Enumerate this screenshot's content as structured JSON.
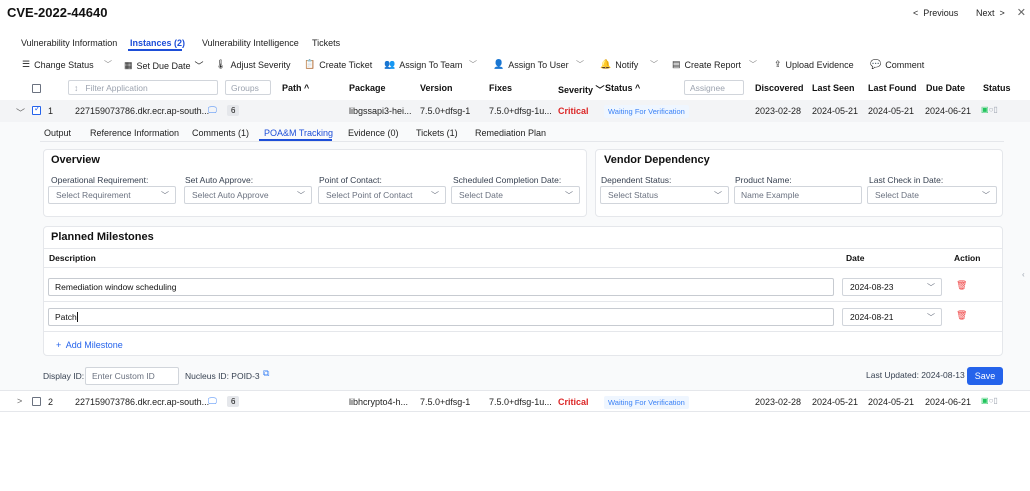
{
  "header": {
    "title": "CVE-2022-44640",
    "previous": "Previous",
    "next": "Next"
  },
  "tabs": [
    {
      "label": "Vulnerability Information"
    },
    {
      "label": "Instances (2)"
    },
    {
      "label": "Vulnerability Intelligence"
    },
    {
      "label": "Tickets"
    }
  ],
  "toolbar": {
    "change_status": "Change Status",
    "set_due_date": "Set Due Date",
    "adjust_severity": "Adjust Severity",
    "create_ticket": "Create Ticket",
    "assign_team": "Assign To Team",
    "assign_user": "Assign To User",
    "notify": "Notify",
    "create_report": "Create Report",
    "upload_evidence": "Upload Evidence",
    "comment": "Comment"
  },
  "table": {
    "filter_application_placeholder": "Filter Application",
    "groups_placeholder": "Groups",
    "assignee_placeholder": "Assignee",
    "headers": {
      "path": "Path",
      "package": "Package",
      "version": "Version",
      "fixes": "Fixes",
      "severity": "Severity",
      "status": "Status",
      "discovered": "Discovered",
      "last_seen": "Last Seen",
      "last_found": "Last Found",
      "due_date": "Due Date",
      "status2": "Status"
    },
    "rows": [
      {
        "index": "1",
        "application": "227159073786.dkr.ecr.ap-south...",
        "groups": "6",
        "package": "libgssapi3-hei...",
        "version": "7.5.0+dfsg-1",
        "fixes": "7.5.0+dfsg-1u...",
        "severity": "Critical",
        "status": "Waiting For Verification",
        "discovered": "2023-02-28",
        "last_seen": "2024-05-21",
        "last_found": "2024-05-21",
        "due_date": "2024-06-21"
      },
      {
        "index": "2",
        "application": "227159073786.dkr.ecr.ap-south...",
        "groups": "6",
        "package": "libhcrypto4-h...",
        "version": "7.5.0+dfsg-1",
        "fixes": "7.5.0+dfsg-1u...",
        "severity": "Critical",
        "status": "Waiting For Verification",
        "discovered": "2023-02-28",
        "last_seen": "2024-05-21",
        "last_found": "2024-05-21",
        "due_date": "2024-06-21"
      }
    ]
  },
  "subtabs": [
    {
      "label": "Output"
    },
    {
      "label": "Reference Information"
    },
    {
      "label": "Comments (1)"
    },
    {
      "label": "POA&M Tracking"
    },
    {
      "label": "Evidence (0)"
    },
    {
      "label": "Tickets (1)"
    },
    {
      "label": "Remediation Plan"
    }
  ],
  "overview": {
    "title": "Overview",
    "operational_requirement_label": "Operational Requirement:",
    "operational_requirement_value": "Select Requirement",
    "auto_approve_label": "Set Auto Approve:",
    "auto_approve_value": "Select Auto Approve",
    "point_of_contact_label": "Point of Contact:",
    "point_of_contact_value": "Select Point of Contact",
    "completion_date_label": "Scheduled Completion Date:",
    "completion_date_value": "Select Date"
  },
  "vendor": {
    "title": "Vendor Dependency",
    "dependent_status_label": "Dependent Status:",
    "dependent_status_value": "Select Status",
    "product_name_label": "Product Name:",
    "product_name_placeholder": "Name Example",
    "last_check_label": "Last Check in Date:",
    "last_check_value": "Select Date"
  },
  "milestones": {
    "title": "Planned Milestones",
    "description_header": "Description",
    "date_header": "Date",
    "action_header": "Action",
    "items": [
      {
        "description": "Remediation window scheduling",
        "date": "2024-08-23"
      },
      {
        "description": "Patch",
        "date": "2024-08-21"
      }
    ],
    "add_label": "Add Milestone"
  },
  "footer": {
    "display_id_label": "Display ID:",
    "display_id_placeholder": "Enter Custom ID",
    "nucleus_id": "Nucleus ID: POID-3",
    "last_updated": "Last Updated: 2024-08-13",
    "save_label": "Save"
  },
  "colors": {
    "accent": "#2563eb",
    "critical": "#dc2626",
    "status_badge_bg": "#eff6ff"
  }
}
